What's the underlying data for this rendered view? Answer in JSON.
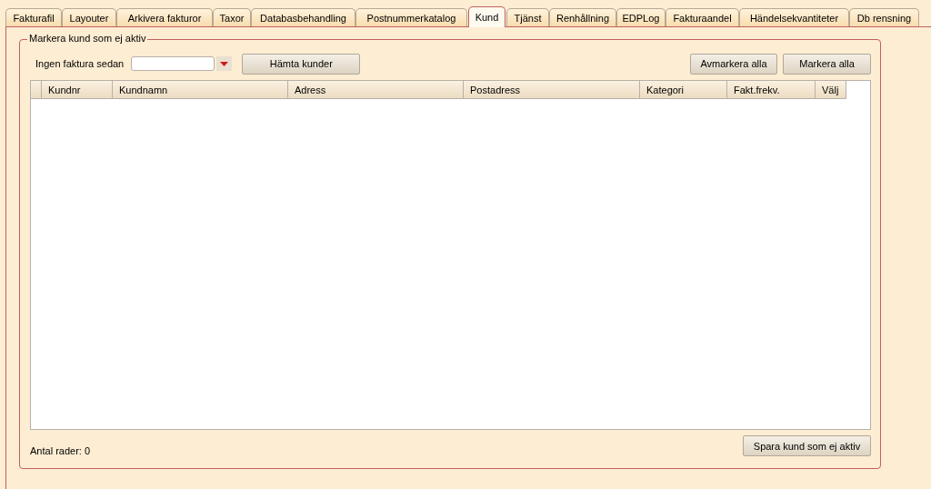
{
  "tabs": [
    {
      "label": "Fakturafil",
      "selected": false
    },
    {
      "label": "Layouter",
      "selected": false
    },
    {
      "label": "Arkivera fakturor",
      "selected": false
    },
    {
      "label": "Taxor",
      "selected": false
    },
    {
      "label": "Databasbehandling",
      "selected": false
    },
    {
      "label": "Postnummerkatalog",
      "selected": false
    },
    {
      "label": "Kund",
      "selected": true
    },
    {
      "label": "Tjänst",
      "selected": false
    },
    {
      "label": "Renhållning",
      "selected": false
    },
    {
      "label": "EDPLog",
      "selected": false
    },
    {
      "label": "Fakturaandel",
      "selected": false
    },
    {
      "label": "Händelsekvantiteter",
      "selected": false
    },
    {
      "label": "Db rensning",
      "selected": false
    }
  ],
  "group": {
    "title": "Markera kund som ej aktiv",
    "date_label": "Ingen faktura sedan",
    "fetch_button": "Hämta kunder",
    "unmark_button": "Avmarkera alla",
    "mark_button": "Markera alla",
    "table": {
      "columns": [
        "Kundnr",
        "Kundnamn",
        "Adress",
        "Postadress",
        "Kategori",
        "Fakt.frekv.",
        "Välj"
      ]
    },
    "row_count": "Antal rader: 0",
    "save_button": "Spara kund som ej aktiv"
  }
}
